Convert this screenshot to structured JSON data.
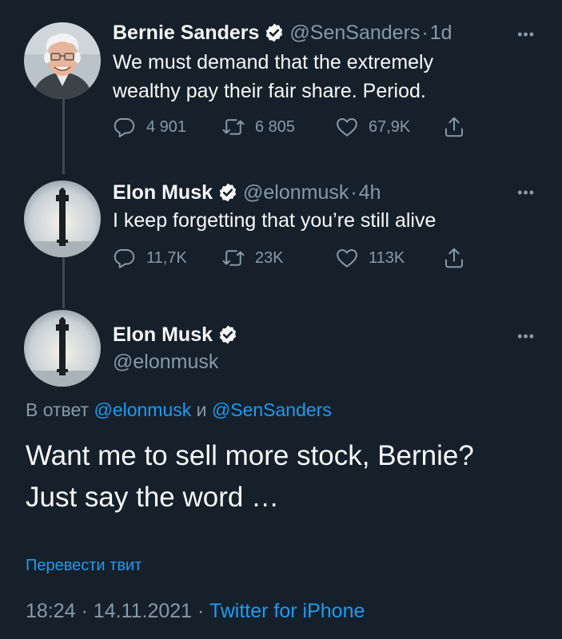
{
  "tweets": [
    {
      "name": "Bernie Sanders",
      "handle": "@SenSanders",
      "dot": "·",
      "time": "1d",
      "text_lines": [
        "We must demand that the extremely",
        "wealthy pay their fair share. Period."
      ],
      "replies": "4 901",
      "retweets": "6 805",
      "likes": "67,9K"
    },
    {
      "name": "Elon Musk",
      "handle": "@elonmusk",
      "dot": "·",
      "time": "4h",
      "text_lines": [
        "I keep forgetting that you’re still alive"
      ],
      "replies": "11,7K",
      "retweets": "23K",
      "likes": "113K"
    }
  ],
  "main_tweet": {
    "name": "Elon Musk",
    "handle": "@elonmusk",
    "reply_prefix": "В ответ",
    "reply_mention_1": "@elonmusk",
    "reply_conj": "и",
    "reply_mention_2": "@SenSanders",
    "text_lines": [
      "Want me to sell more stock, Bernie?",
      "Just say the word …"
    ],
    "translate_label": "Перевести твит",
    "time": "18:24",
    "date": "14.11.2021",
    "sep": "·",
    "source": "Twitter for iPhone"
  },
  "more_label": "•••",
  "colors": {
    "background": "#15202b",
    "text": "#f7f9f9",
    "secondary": "#8899a6",
    "accent": "#1d9bf0",
    "thread_line": "#3b4a56"
  },
  "icons": [
    "verified-badge-icon",
    "reply-icon",
    "retweet-icon",
    "like-icon",
    "share-icon",
    "more-icon"
  ]
}
